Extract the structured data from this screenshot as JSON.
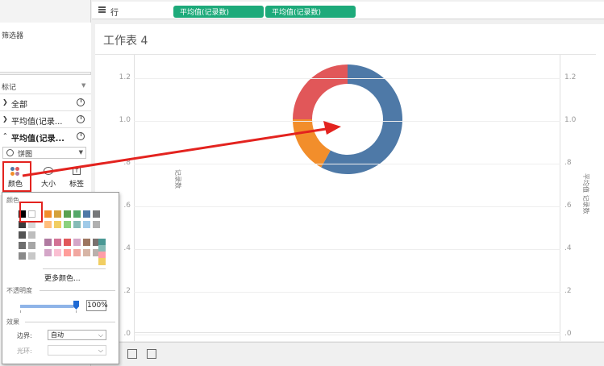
{
  "rows_shelf": {
    "label": "行",
    "pills": [
      "平均值(记录数)",
      "平均值(记录数)"
    ]
  },
  "filters": {
    "title": "筛选器"
  },
  "marks": {
    "title": "标记",
    "rows": [
      {
        "label": "全部",
        "chevron": "›"
      },
      {
        "label": "平均值(记录...",
        "chevron": "›"
      },
      {
        "label": "平均值(记录...",
        "chevron": "⌃"
      }
    ],
    "mark_type": "饼图",
    "buttons": {
      "color": "颜色",
      "size": "大小",
      "label": "标签"
    }
  },
  "sheet": {
    "title": "工作表 4",
    "left_ticks": [
      "1.2",
      "1.0",
      ".8",
      ".6",
      ".4",
      ".2",
      ".0"
    ],
    "right_ticks": [
      "1.2",
      "1.0",
      ".8",
      ".6",
      ".4",
      ".2",
      ".0"
    ],
    "left_axis_label": "记录数",
    "right_axis_label": "平均值 记录数"
  },
  "chart_data": {
    "type": "pie",
    "hole": "donut",
    "slices": [
      {
        "share": 0.58,
        "color": "#4e79a7"
      },
      {
        "share": 0.17,
        "color": "#f28e2b"
      },
      {
        "share": 0.25,
        "color": "#e15759"
      }
    ]
  },
  "color_popup": {
    "section_color": "颜色",
    "more_colors": "更多颜色...",
    "section_opacity": "不透明度",
    "opacity_value": "100%",
    "opacity_level": 1.0,
    "section_effects": "效果",
    "border_label": "边界:",
    "border_value": "自动",
    "halo_label": "光环:",
    "halo_value": ""
  },
  "colors": {
    "pill": "#1daa7a",
    "annotation": "#e3231f",
    "mono": [
      "#000000",
      "#ffffff",
      "#3c3c3c",
      "#d9d9d9",
      "#545454",
      "#bdbdbd",
      "#6e6e6e",
      "#a6a6a6",
      "#8a8a8a",
      "#c8c8c8"
    ],
    "palette_row1": [
      "#f28e2b",
      "#d4a13a",
      "#59a14f",
      "#55a868",
      "#4e79a7",
      "#76787a"
    ],
    "palette_row2": [
      "#ffbe7d",
      "#f1ce63",
      "#8cd17d",
      "#86bcb6",
      "#a0cbe8",
      "#b0b0b0"
    ],
    "palette_row3": [
      "#b07aa1",
      "#d37295",
      "#e15759",
      "#d4a6c8",
      "#9d7660",
      "#79706e"
    ],
    "palette_row4": [
      "#d4a6c8",
      "#fabfd2",
      "#ff9d9a",
      "#f1a7a0",
      "#d7b5a6",
      "#bab0ac"
    ],
    "teal_col": [
      "#499894",
      "#86bcb6",
      "#ff9da7",
      "#f1ce63"
    ]
  }
}
